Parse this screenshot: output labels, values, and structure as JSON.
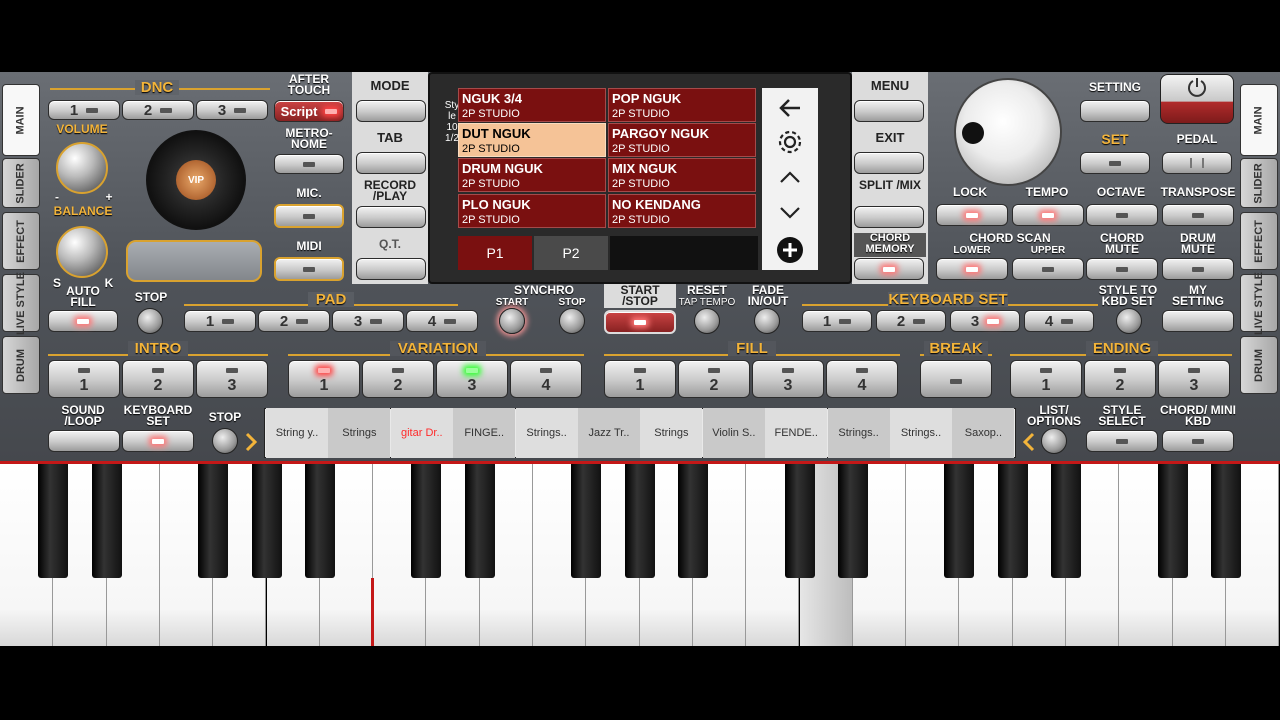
{
  "side_left": [
    "MAIN",
    "SLIDER",
    "EFFECT",
    "LIVE STYLE",
    "DRUM"
  ],
  "side_right": [
    "MAIN",
    "SLIDER",
    "EFFECT",
    "LIVE STYLE",
    "DRUM"
  ],
  "dnc": {
    "title": "DNC",
    "buttons": [
      "1",
      "2",
      "3"
    ]
  },
  "after_touch": "AFTER TOUCH",
  "script_label": "Script",
  "volume": "VOLUME",
  "balance": "BALANCE",
  "bal_s": "S",
  "bal_k": "K",
  "vol_minus": "-",
  "vol_plus": "+",
  "vip": "VIP",
  "metronome": "METRO- NOME",
  "mic": "MIC.",
  "midi": "MIDI",
  "left_menu": {
    "mode": "MODE",
    "tab": "TAB",
    "record": "RECORD /PLAY",
    "qt": "Q.T."
  },
  "styles": {
    "vertical": "Style 10 1/2",
    "items": [
      {
        "name": "NGUK 3/4",
        "sub": "2P STUDIO"
      },
      {
        "name": "POP NGUK",
        "sub": "2P STUDIO"
      },
      {
        "name": "DUT NGUK",
        "sub": "2P STUDIO"
      },
      {
        "name": "PARGOY NGUK",
        "sub": "2P STUDIO"
      },
      {
        "name": "DRUM NGUK",
        "sub": "2P STUDIO"
      },
      {
        "name": "MIX NGUK",
        "sub": "2P STUDIO"
      },
      {
        "name": "PLO NGUK",
        "sub": "2P STUDIO"
      },
      {
        "name": "NO KENDANG",
        "sub": "2P STUDIO"
      }
    ],
    "pages": [
      "P1",
      "P2"
    ]
  },
  "right_menu": {
    "menu": "MENU",
    "exit": "EXIT",
    "split": "SPLIT /MIX",
    "chord_memory": "CHORD MEMORY"
  },
  "setting": "SETTING",
  "set": "SET",
  "pedal": "PEDAL",
  "lock": "LOCK",
  "tempo": "TEMPO",
  "octave": "OCTAVE",
  "transpose": "TRANSPOSE",
  "chord_scan": "CHORD SCAN",
  "lower": "LOWER",
  "upper": "UPPER",
  "chord_mute": "CHORD MUTE",
  "drum_mute": "DRUM MUTE",
  "auto_fill": "AUTO FILL",
  "stop": "STOP",
  "pad": {
    "title": "PAD",
    "buttons": [
      "1",
      "2",
      "3",
      "4"
    ]
  },
  "synchro": "SYNCHRO",
  "sync_start": "START",
  "sync_stop": "STOP",
  "start_stop": "START /STOP",
  "reset": "RESET",
  "tap_tempo": "TAP TEMPO",
  "fade": "FADE IN/OUT",
  "keyboard_set": {
    "title": "KEYBOARD SET",
    "buttons": [
      "1",
      "2",
      "3",
      "4"
    ]
  },
  "style_to_kbd": "STYLE TO KBD SET",
  "my_setting": "MY SETTING",
  "intro": {
    "title": "INTRO",
    "buttons": [
      "1",
      "2",
      "3"
    ]
  },
  "variation": {
    "title": "VARIATION",
    "buttons": [
      "1",
      "2",
      "3",
      "4"
    ]
  },
  "fill": {
    "title": "FILL",
    "buttons": [
      "1",
      "2",
      "3",
      "4"
    ]
  },
  "break": "BREAK",
  "ending": {
    "title": "ENDING",
    "buttons": [
      "1",
      "2",
      "3"
    ]
  },
  "sound_loop": "SOUND /LOOP",
  "keyboard_set_btn": "KEYBOARD SET",
  "stop2": "STOP",
  "voices": [
    "String y..",
    "Strings",
    "gitar Dr..",
    "FINGE..",
    "Strings..",
    "Jazz Tr..",
    "Strings",
    "Violin S..",
    "FENDE..",
    "Strings..",
    "Strings..",
    "Saxop.."
  ],
  "list_options": "LIST/ OPTIONS",
  "style_select": "STYLE SELECT",
  "chord_mini": "CHORD/ MINI KBD",
  "colors": {
    "accent": "#d9a22f",
    "selected_voice": "#ff2a2a",
    "screen_cell": "#7a1010",
    "screen_sel": "#f5c397"
  }
}
